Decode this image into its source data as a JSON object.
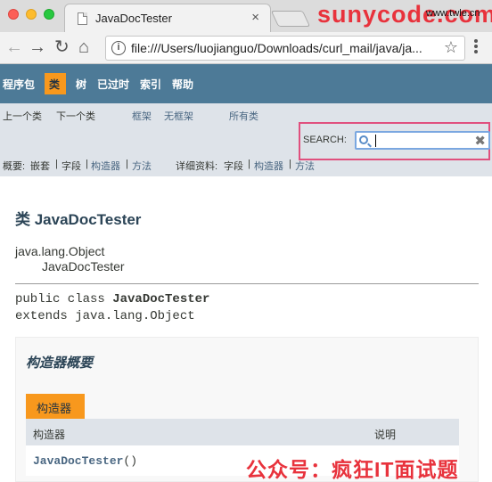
{
  "browser": {
    "tab_title": "JavaDocTester",
    "tab_close": "×",
    "url": "file:///Users/luojianguo/Downloads/curl_mail/java/ja...",
    "watermark": "sunycode.com",
    "watermark_small": "www.twle.cn",
    "icons": {
      "back": "◀-arrow",
      "forward": "arrow-right",
      "reload": "reload",
      "home": "home",
      "info": "info",
      "star": "star",
      "menu": "menu-dots"
    }
  },
  "topnav": {
    "items": [
      "程序包",
      "类",
      "树",
      "已过时",
      "索引",
      "帮助"
    ],
    "active": "类"
  },
  "subnav": {
    "prev_class": "上一个类",
    "next_class": "下一个类",
    "frames": "框架",
    "no_frames": "无框架",
    "all_classes": "所有类",
    "search_label": "SEARCH:",
    "summary_label": "概要:",
    "summary_nested": "嵌套",
    "summary_field": "字段",
    "summary_constr": "构造器",
    "summary_method": "方法",
    "detail_label": "详细资料:",
    "detail_field": "字段",
    "detail_constr": "构造器",
    "detail_method": "方法",
    "sep": "|"
  },
  "content": {
    "title": "类 JavaDocTester",
    "inherit_parent": "java.lang.Object",
    "inherit_child": "JavaDocTester",
    "sig_line1_prefix": "public class ",
    "sig_line1_name": "JavaDocTester",
    "sig_line2": "extends java.lang.Object",
    "summary_heading": "构造器概要",
    "caption": "构造器",
    "col_constructor": "构造器",
    "col_description": "说明",
    "row_name": "JavaDocTester",
    "row_parens": "()",
    "bottom_watermark": "公众号：疯狂IT面试题"
  }
}
